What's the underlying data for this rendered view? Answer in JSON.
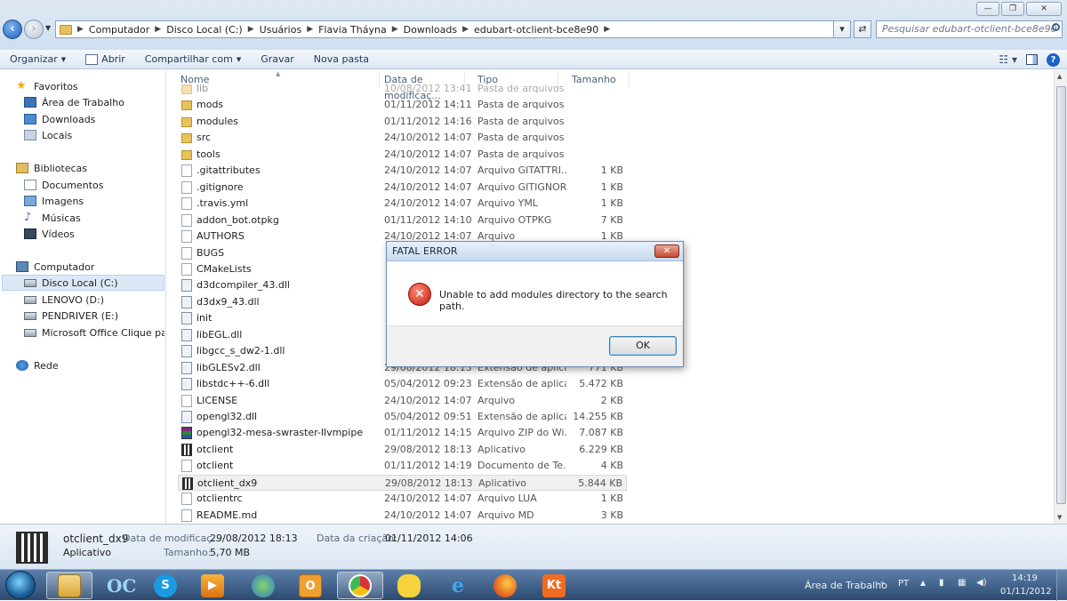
{
  "window": {
    "controls": {
      "minimize": "—",
      "maximize": "❐",
      "close": "✕"
    }
  },
  "address": {
    "crumbs": [
      "Computador",
      "Disco Local (C:)",
      "Usuários",
      "Flavia Tháyna",
      "Downloads",
      "edubart-otclient-bce8e90"
    ],
    "search_placeholder": "Pesquisar edubart-otclient-bce8e90"
  },
  "toolbar": {
    "organize": "Organizar",
    "open": "Abrir",
    "share": "Compartilhar com",
    "burn": "Gravar",
    "new_folder": "Nova pasta"
  },
  "nav": {
    "favorites_header": "Favoritos",
    "favorites": [
      "Área de Trabalho",
      "Downloads",
      "Locais"
    ],
    "libraries_header": "Bibliotecas",
    "libraries": [
      "Documentos",
      "Imagens",
      "Músicas",
      "Vídeos"
    ],
    "computer_header": "Computador",
    "drives": [
      "Disco Local (C:)",
      "LENOVO (D:)",
      "PENDRIVER (E:)",
      "Microsoft Office Clique para Executar"
    ],
    "network": "Rede"
  },
  "columns": {
    "name": "Nome",
    "date": "Data de modificaç...",
    "type": "Tipo",
    "size": "Tamanho"
  },
  "files": [
    {
      "icon": "folder",
      "name": "lib",
      "date": "10/08/2012 13:41",
      "type": "Pasta de arquivos",
      "size": ""
    },
    {
      "icon": "folder",
      "name": "mods",
      "date": "01/11/2012 14:11",
      "type": "Pasta de arquivos",
      "size": ""
    },
    {
      "icon": "folder",
      "name": "modules",
      "date": "01/11/2012 14:16",
      "type": "Pasta de arquivos",
      "size": ""
    },
    {
      "icon": "folder",
      "name": "src",
      "date": "24/10/2012 14:07",
      "type": "Pasta de arquivos",
      "size": ""
    },
    {
      "icon": "folder",
      "name": "tools",
      "date": "24/10/2012 14:07",
      "type": "Pasta de arquivos",
      "size": ""
    },
    {
      "icon": "file",
      "name": ".gitattributes",
      "date": "24/10/2012 14:07",
      "type": "Arquivo GITATTRI...",
      "size": "1 KB"
    },
    {
      "icon": "file",
      "name": ".gitignore",
      "date": "24/10/2012 14:07",
      "type": "Arquivo GITIGNORE",
      "size": "1 KB"
    },
    {
      "icon": "file",
      "name": ".travis.yml",
      "date": "24/10/2012 14:07",
      "type": "Arquivo YML",
      "size": "1 KB"
    },
    {
      "icon": "file",
      "name": "addon_bot.otpkg",
      "date": "01/11/2012 14:10",
      "type": "Arquivo OTPKG",
      "size": "7 KB"
    },
    {
      "icon": "file",
      "name": "AUTHORS",
      "date": "24/10/2012 14:07",
      "type": "Arquivo",
      "size": "1 KB"
    },
    {
      "icon": "file",
      "name": "BUGS",
      "date": "",
      "type": "",
      "size": ""
    },
    {
      "icon": "file",
      "name": "CMakeLists",
      "date": "",
      "type": "",
      "size": ""
    },
    {
      "icon": "gear",
      "name": "d3dcompiler_43.dll",
      "date": "",
      "type": "",
      "size": ""
    },
    {
      "icon": "gear",
      "name": "d3dx9_43.dll",
      "date": "",
      "type": "",
      "size": ""
    },
    {
      "icon": "gear",
      "name": "init",
      "date": "",
      "type": "",
      "size": ""
    },
    {
      "icon": "gear",
      "name": "libEGL.dll",
      "date": "",
      "type": "",
      "size": ""
    },
    {
      "icon": "gear",
      "name": "libgcc_s_dw2-1.dll",
      "date": "",
      "type": "",
      "size": ""
    },
    {
      "icon": "gear",
      "name": "libGLESv2.dll",
      "date": "29/08/2012 18:13",
      "type": "Extensão de aplica...",
      "size": "771 KB"
    },
    {
      "icon": "gear",
      "name": "libstdc++-6.dll",
      "date": "05/04/2012 09:23",
      "type": "Extensão de aplica...",
      "size": "5.472 KB"
    },
    {
      "icon": "file",
      "name": "LICENSE",
      "date": "24/10/2012 14:07",
      "type": "Arquivo",
      "size": "2 KB"
    },
    {
      "icon": "gear",
      "name": "opengl32.dll",
      "date": "05/04/2012 09:51",
      "type": "Extensão de aplica...",
      "size": "14.255 KB"
    },
    {
      "icon": "zip",
      "name": "opengl32-mesa-swraster-llvmpipe",
      "date": "01/11/2012 14:15",
      "type": "Arquivo ZIP do Wi...",
      "size": "7.087 KB"
    },
    {
      "icon": "app",
      "name": "otclient",
      "date": "29/08/2012 18:13",
      "type": "Aplicativo",
      "size": "6.229 KB"
    },
    {
      "icon": "file",
      "name": "otclient",
      "date": "01/11/2012 14:19",
      "type": "Documento de Te...",
      "size": "4 KB"
    },
    {
      "icon": "app",
      "name": "otclient_dx9",
      "date": "29/08/2012 18:13",
      "type": "Aplicativo",
      "size": "5.844 KB"
    },
    {
      "icon": "file",
      "name": "otclientrc",
      "date": "24/10/2012 14:07",
      "type": "Arquivo LUA",
      "size": "1 KB"
    },
    {
      "icon": "file",
      "name": "README.md",
      "date": "24/10/2012 14:07",
      "type": "Arquivo MD",
      "size": "3 KB"
    }
  ],
  "details": {
    "name": "otclient_dx9",
    "kind": "Aplicativo",
    "modified_label": "Data de modificaç...",
    "modified_value": "29/08/2012 18:13",
    "created_label": "Data da criação:",
    "created_value": "01/11/2012 14:06",
    "size_label": "Tamanho:",
    "size_value": "5,70 MB"
  },
  "dialog": {
    "title": "FATAL ERROR",
    "message": "Unable to add modules directory to the search path.",
    "ok": "OK",
    "close": "✕"
  },
  "taskbar": {
    "desktop_label": "Área de Trabalho",
    "lang": "PT",
    "time": "14:19",
    "date": "01/11/2012",
    "apps": [
      "windows-explorer",
      "otclient",
      "skype",
      "media-player",
      "messenger",
      "outlook",
      "chrome",
      "pokemon",
      "internet-explorer",
      "firefox",
      "kt-app"
    ]
  }
}
